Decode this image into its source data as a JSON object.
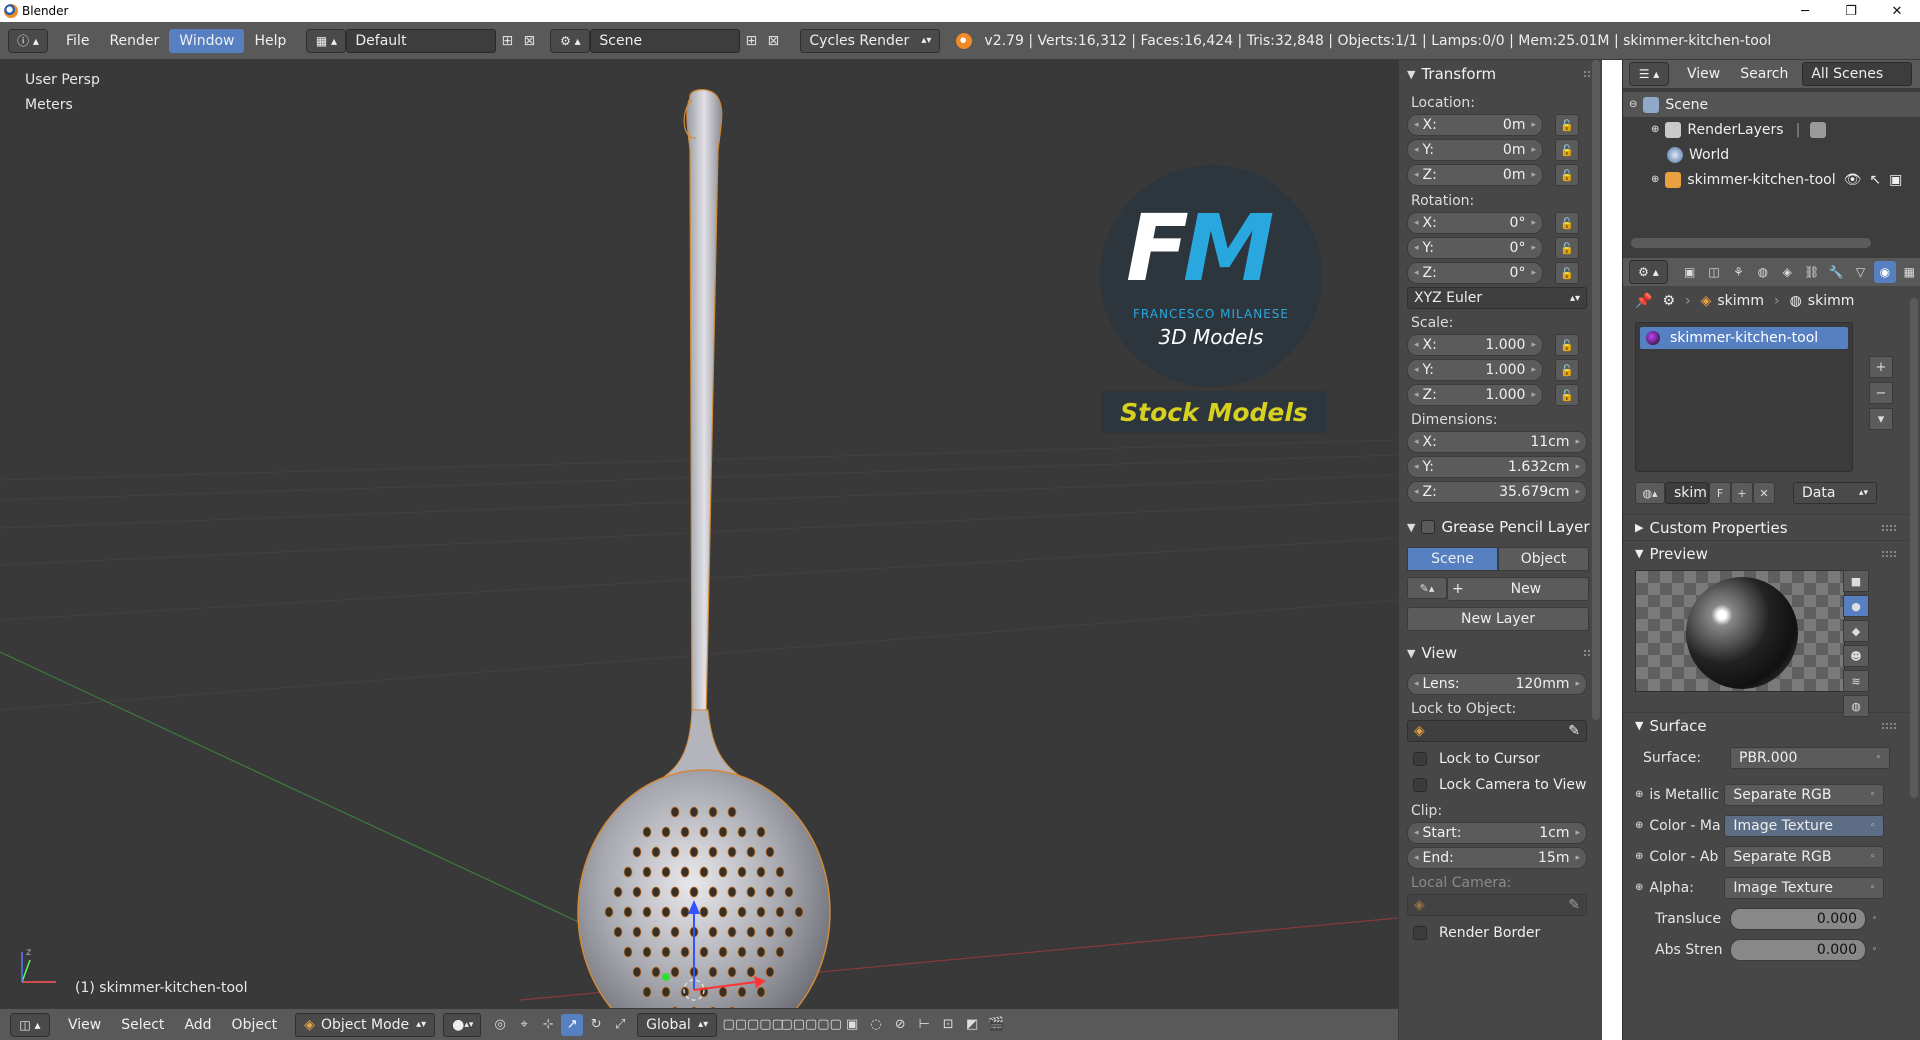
{
  "window": {
    "title": "Blender",
    "minimize": "─",
    "maximize": "❐",
    "close": "✕"
  },
  "topbar": {
    "menu": [
      "File",
      "Render",
      "Window",
      "Help"
    ],
    "active_menu": "Window",
    "screen_layout": "Default",
    "scene_name": "Scene",
    "render_engine": "Cycles Render",
    "stats": "v2.79 | Verts:16,312 | Faces:16,424 | Tris:32,848 | Objects:1/1 | Lamps:0/0 | Mem:25.01M | skimmer-kitchen-tool"
  },
  "viewport": {
    "view_name": "User Persp",
    "units": "Meters",
    "object_label": "(1) skimmer-kitchen-tool",
    "watermark": {
      "initials_f": "F",
      "initials_m": "M",
      "name": "FRANCESCO MILANESE",
      "subtitle": "3D Models",
      "banner": "Stock Models"
    }
  },
  "viewport_header": {
    "menus": [
      "View",
      "Select",
      "Add",
      "Object"
    ],
    "mode": "Object Mode",
    "orientation": "Global"
  },
  "npanel": {
    "transform": {
      "title": "Transform",
      "location_label": "Location:",
      "location": [
        {
          "k": "X:",
          "v": "0m"
        },
        {
          "k": "Y:",
          "v": "0m"
        },
        {
          "k": "Z:",
          "v": "0m"
        }
      ],
      "rotation_label": "Rotation:",
      "rotation": [
        {
          "k": "X:",
          "v": "0°"
        },
        {
          "k": "Y:",
          "v": "0°"
        },
        {
          "k": "Z:",
          "v": "0°"
        }
      ],
      "rotation_mode": "XYZ Euler",
      "scale_label": "Scale:",
      "scale": [
        {
          "k": "X:",
          "v": "1.000"
        },
        {
          "k": "Y:",
          "v": "1.000"
        },
        {
          "k": "Z:",
          "v": "1.000"
        }
      ],
      "dimensions_label": "Dimensions:",
      "dimensions": [
        {
          "k": "X:",
          "v": "11cm"
        },
        {
          "k": "Y:",
          "v": "1.632cm"
        },
        {
          "k": "Z:",
          "v": "35.679cm"
        }
      ]
    },
    "grease_pencil": {
      "title": "Grease Pencil Layer",
      "tab_scene": "Scene",
      "tab_object": "Object",
      "new_label": "New",
      "new_layer_label": "New Layer"
    },
    "view": {
      "title": "View",
      "lens_k": "Lens:",
      "lens_v": "120mm",
      "lock_to_object": "Lock to Object:",
      "lock_to_cursor": "Lock to Cursor",
      "lock_camera": "Lock Camera to View",
      "clip_label": "Clip:",
      "clip_start_k": "Start:",
      "clip_start_v": "1cm",
      "clip_end_k": "End:",
      "clip_end_v": "15m",
      "local_camera": "Local Camera:",
      "render_border": "Render Border"
    }
  },
  "outliner": {
    "menu_view": "View",
    "menu_search": "Search",
    "filter": "All Scenes",
    "items": [
      "Scene",
      "RenderLayers",
      "World",
      "skimmer-kitchen-tool"
    ]
  },
  "properties": {
    "breadcrumb_object": "skimm",
    "breadcrumb_material": "skimm",
    "material_slot": "skimmer-kitchen-tool",
    "material_name": "skim",
    "fake_user": "F",
    "link_mode": "Data",
    "custom_properties": "Custom Properties",
    "preview": "Preview",
    "surface_title": "Surface",
    "surface_rows": [
      {
        "label": "Surface:",
        "value": "PBR.000"
      },
      {
        "label": "is Metallic",
        "value": "Separate RGB"
      },
      {
        "label": "Color - Ma",
        "value": "Image Texture"
      },
      {
        "label": "Color - Ab",
        "value": "Separate RGB"
      },
      {
        "label": "Alpha:",
        "value": "Image Texture"
      }
    ],
    "translucent_label": "Transluce",
    "translucent_value": "0.000",
    "abs_strength_label": "Abs Stren",
    "abs_strength_value": "0.000"
  }
}
